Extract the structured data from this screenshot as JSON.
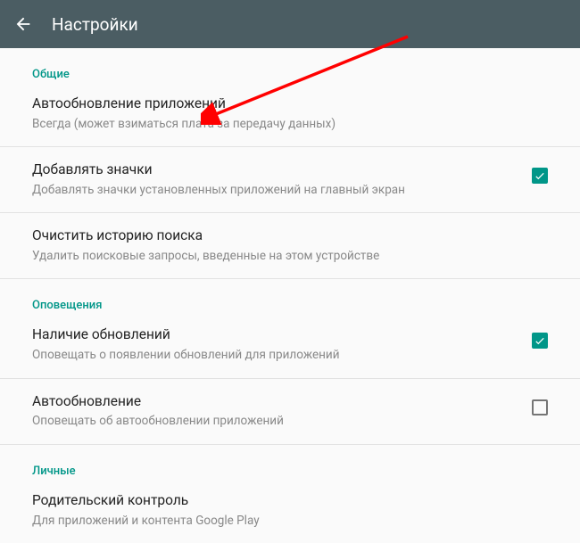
{
  "appbar": {
    "title": "Настройки"
  },
  "sections": {
    "general": {
      "header": "Общие",
      "auto_update": {
        "title": "Автообновление приложений",
        "sub": "Всегда (может взиматься плата за передачу данных)"
      },
      "add_icons": {
        "title": "Добавлять значки",
        "sub": "Добавлять значки установленных приложений на главный экран",
        "checked": true
      },
      "clear_history": {
        "title": "Очистить историю поиска",
        "sub": "Удалить поисковые запросы, введенные на этом устройстве"
      }
    },
    "notifications": {
      "header": "Оповещения",
      "updates_available": {
        "title": "Наличие обновлений",
        "sub": "Оповещать о появлении обновлений для приложений",
        "checked": true
      },
      "auto_update_notify": {
        "title": "Автообновление",
        "sub": "Оповещать об автообновлении приложений",
        "checked": false
      }
    },
    "personal": {
      "header": "Личные",
      "parental": {
        "title": "Родительский контроль",
        "sub": "Для приложений и контента Google Play"
      }
    }
  },
  "colors": {
    "accent": "#009688",
    "appbar": "#4b5d63"
  },
  "annotation": {
    "arrow_color": "#ff0000"
  }
}
